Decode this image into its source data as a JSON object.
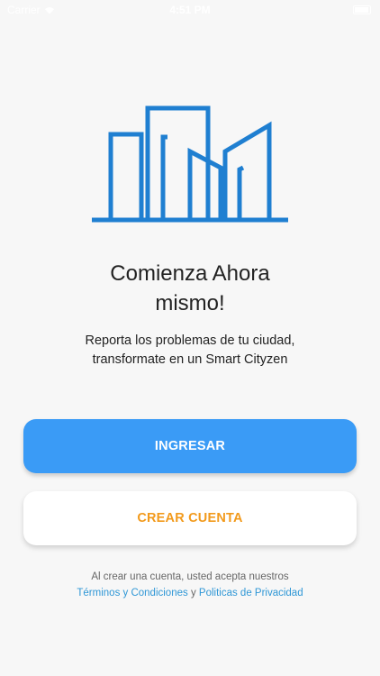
{
  "status_bar": {
    "carrier": "Carrier",
    "time": "4:51 PM"
  },
  "logo": {
    "icon": "city-buildings-icon",
    "color": "#1f7fd1"
  },
  "headline": {
    "line1": "Comienza Ahora",
    "line2": "mismo!"
  },
  "subtitle": {
    "line1": "Reporta los problemas de tu ciudad,",
    "line2": "transformate en un Smart Cityzen"
  },
  "buttons": {
    "login_label": "INGRESAR",
    "create_account_label": "CREAR CUENTA"
  },
  "terms": {
    "prefix": "Al crear una cuenta, usted acepta nuestros",
    "terms_link": "Términos y Condiciones",
    "conjunction": "y",
    "privacy_link": "Politicas de Privacidad"
  },
  "colors": {
    "primary": "#3a9bf6",
    "accent": "#f29a1c",
    "link": "#2f97d6"
  }
}
